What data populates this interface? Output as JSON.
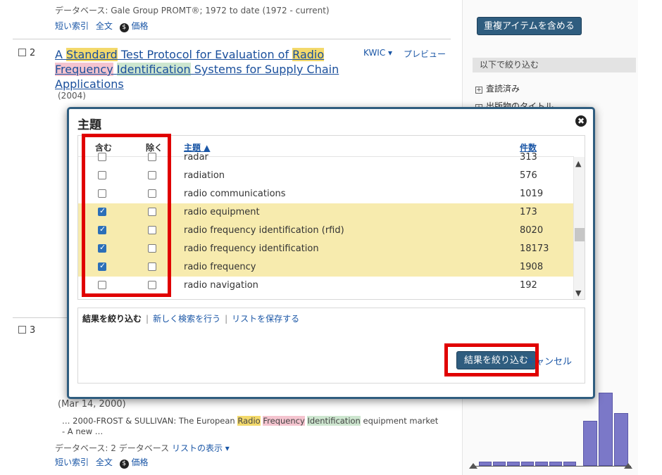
{
  "results": {
    "top": {
      "database_line": "データベース: Gale Group PROMT®; 1972 to date (1972 - current)",
      "links": [
        "短い索引",
        "全文",
        "価格"
      ]
    },
    "item2": {
      "number": "2",
      "title_parts": [
        "A ",
        "Standard",
        " Test Protocol for Evaluation of ",
        "Radio",
        " ",
        "Frequency",
        " ",
        "Identification",
        " Systems for Supply Chain Applications"
      ],
      "year": "(2004)",
      "kwic": "KWIC ▾",
      "preview": "プレビュー"
    },
    "item3": {
      "number": "3",
      "date": "(Mar 14, 2000)",
      "snippet_parts": [
        "… 2000-FROST & SULLIVAN: The European ",
        "Radio",
        " ",
        "Frequency",
        " ",
        "Identification",
        " equipment market - A new …"
      ],
      "database_line": "データベース: 2 データベース",
      "list_link": "リストの表示 ▾",
      "links": [
        "短い索引",
        "全文",
        "価格"
      ]
    }
  },
  "sidebar": {
    "include_dupes_button": "重複アイテムを含める",
    "narrow_header": "以下で絞り込む",
    "items": [
      "査読済み",
      "出版物のタイトル"
    ]
  },
  "modal": {
    "title": "主題",
    "close": "✖",
    "headers": {
      "include": "含む",
      "exclude": "除く",
      "subject": "主題 ▲",
      "count": "件数"
    },
    "rows": [
      {
        "label": "radar",
        "count": "313",
        "include": false,
        "exclude": false
      },
      {
        "label": "radiation",
        "count": "576",
        "include": false,
        "exclude": false
      },
      {
        "label": "radio communications",
        "count": "1019",
        "include": false,
        "exclude": false
      },
      {
        "label": "radio equipment",
        "count": "173",
        "include": true,
        "exclude": false
      },
      {
        "label": "radio frequency identification (rfid)",
        "count": "8020",
        "include": true,
        "exclude": false
      },
      {
        "label": "radio frequency identification",
        "count": "18173",
        "include": true,
        "exclude": false
      },
      {
        "label": "radio frequency",
        "count": "1908",
        "include": true,
        "exclude": false
      },
      {
        "label": "radio navigation",
        "count": "192",
        "include": false,
        "exclude": false
      }
    ],
    "actions": {
      "narrow": "結果を絞り込む",
      "new_search": "新しく検索を行う",
      "save_list": "リストを保存する"
    },
    "apply_button": "結果を絞り込む",
    "cancel": "キャンセル"
  },
  "colors": {
    "accent": "#2f5d7f",
    "highlight_row": "#f7ebae",
    "annotation_red": "#e00000",
    "histogram_bar": "#7b78c8"
  }
}
